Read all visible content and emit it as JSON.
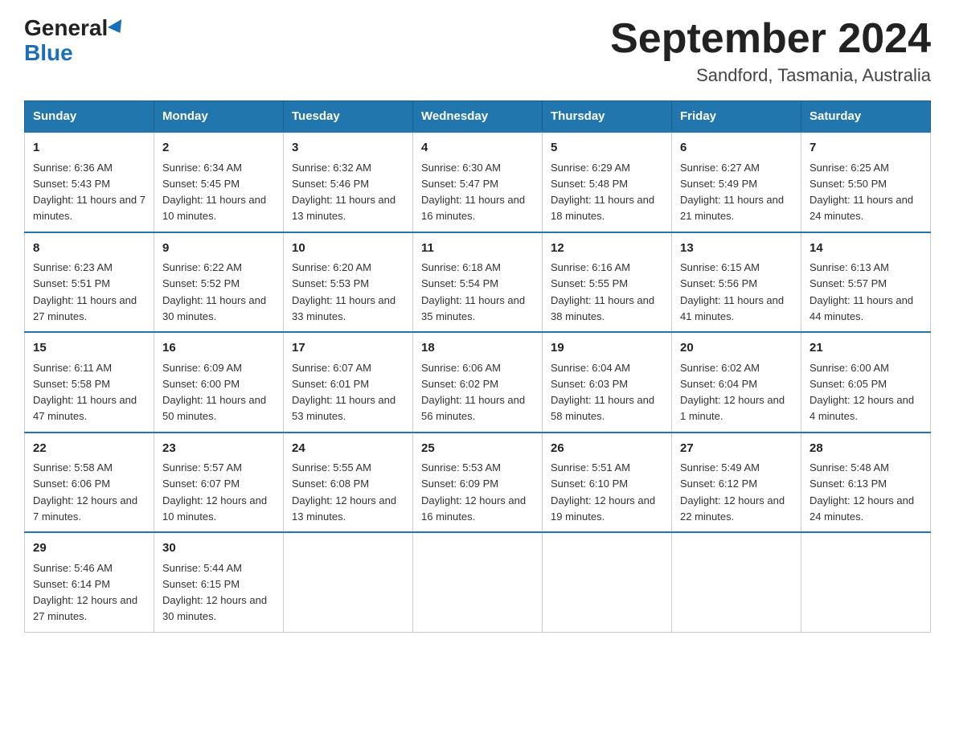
{
  "header": {
    "logo_line1": "General",
    "logo_line2": "Blue",
    "main_title": "September 2024",
    "subtitle": "Sandford, Tasmania, Australia"
  },
  "calendar": {
    "days_of_week": [
      "Sunday",
      "Monday",
      "Tuesday",
      "Wednesday",
      "Thursday",
      "Friday",
      "Saturday"
    ],
    "weeks": [
      [
        {
          "day": "1",
          "sunrise": "6:36 AM",
          "sunset": "5:43 PM",
          "daylight": "11 hours and 7 minutes."
        },
        {
          "day": "2",
          "sunrise": "6:34 AM",
          "sunset": "5:45 PM",
          "daylight": "11 hours and 10 minutes."
        },
        {
          "day": "3",
          "sunrise": "6:32 AM",
          "sunset": "5:46 PM",
          "daylight": "11 hours and 13 minutes."
        },
        {
          "day": "4",
          "sunrise": "6:30 AM",
          "sunset": "5:47 PM",
          "daylight": "11 hours and 16 minutes."
        },
        {
          "day": "5",
          "sunrise": "6:29 AM",
          "sunset": "5:48 PM",
          "daylight": "11 hours and 18 minutes."
        },
        {
          "day": "6",
          "sunrise": "6:27 AM",
          "sunset": "5:49 PM",
          "daylight": "11 hours and 21 minutes."
        },
        {
          "day": "7",
          "sunrise": "6:25 AM",
          "sunset": "5:50 PM",
          "daylight": "11 hours and 24 minutes."
        }
      ],
      [
        {
          "day": "8",
          "sunrise": "6:23 AM",
          "sunset": "5:51 PM",
          "daylight": "11 hours and 27 minutes."
        },
        {
          "day": "9",
          "sunrise": "6:22 AM",
          "sunset": "5:52 PM",
          "daylight": "11 hours and 30 minutes."
        },
        {
          "day": "10",
          "sunrise": "6:20 AM",
          "sunset": "5:53 PM",
          "daylight": "11 hours and 33 minutes."
        },
        {
          "day": "11",
          "sunrise": "6:18 AM",
          "sunset": "5:54 PM",
          "daylight": "11 hours and 35 minutes."
        },
        {
          "day": "12",
          "sunrise": "6:16 AM",
          "sunset": "5:55 PM",
          "daylight": "11 hours and 38 minutes."
        },
        {
          "day": "13",
          "sunrise": "6:15 AM",
          "sunset": "5:56 PM",
          "daylight": "11 hours and 41 minutes."
        },
        {
          "day": "14",
          "sunrise": "6:13 AM",
          "sunset": "5:57 PM",
          "daylight": "11 hours and 44 minutes."
        }
      ],
      [
        {
          "day": "15",
          "sunrise": "6:11 AM",
          "sunset": "5:58 PM",
          "daylight": "11 hours and 47 minutes."
        },
        {
          "day": "16",
          "sunrise": "6:09 AM",
          "sunset": "6:00 PM",
          "daylight": "11 hours and 50 minutes."
        },
        {
          "day": "17",
          "sunrise": "6:07 AM",
          "sunset": "6:01 PM",
          "daylight": "11 hours and 53 minutes."
        },
        {
          "day": "18",
          "sunrise": "6:06 AM",
          "sunset": "6:02 PM",
          "daylight": "11 hours and 56 minutes."
        },
        {
          "day": "19",
          "sunrise": "6:04 AM",
          "sunset": "6:03 PM",
          "daylight": "11 hours and 58 minutes."
        },
        {
          "day": "20",
          "sunrise": "6:02 AM",
          "sunset": "6:04 PM",
          "daylight": "12 hours and 1 minute."
        },
        {
          "day": "21",
          "sunrise": "6:00 AM",
          "sunset": "6:05 PM",
          "daylight": "12 hours and 4 minutes."
        }
      ],
      [
        {
          "day": "22",
          "sunrise": "5:58 AM",
          "sunset": "6:06 PM",
          "daylight": "12 hours and 7 minutes."
        },
        {
          "day": "23",
          "sunrise": "5:57 AM",
          "sunset": "6:07 PM",
          "daylight": "12 hours and 10 minutes."
        },
        {
          "day": "24",
          "sunrise": "5:55 AM",
          "sunset": "6:08 PM",
          "daylight": "12 hours and 13 minutes."
        },
        {
          "day": "25",
          "sunrise": "5:53 AM",
          "sunset": "6:09 PM",
          "daylight": "12 hours and 16 minutes."
        },
        {
          "day": "26",
          "sunrise": "5:51 AM",
          "sunset": "6:10 PM",
          "daylight": "12 hours and 19 minutes."
        },
        {
          "day": "27",
          "sunrise": "5:49 AM",
          "sunset": "6:12 PM",
          "daylight": "12 hours and 22 minutes."
        },
        {
          "day": "28",
          "sunrise": "5:48 AM",
          "sunset": "6:13 PM",
          "daylight": "12 hours and 24 minutes."
        }
      ],
      [
        {
          "day": "29",
          "sunrise": "5:46 AM",
          "sunset": "6:14 PM",
          "daylight": "12 hours and 27 minutes."
        },
        {
          "day": "30",
          "sunrise": "5:44 AM",
          "sunset": "6:15 PM",
          "daylight": "12 hours and 30 minutes."
        },
        null,
        null,
        null,
        null,
        null
      ]
    ]
  }
}
